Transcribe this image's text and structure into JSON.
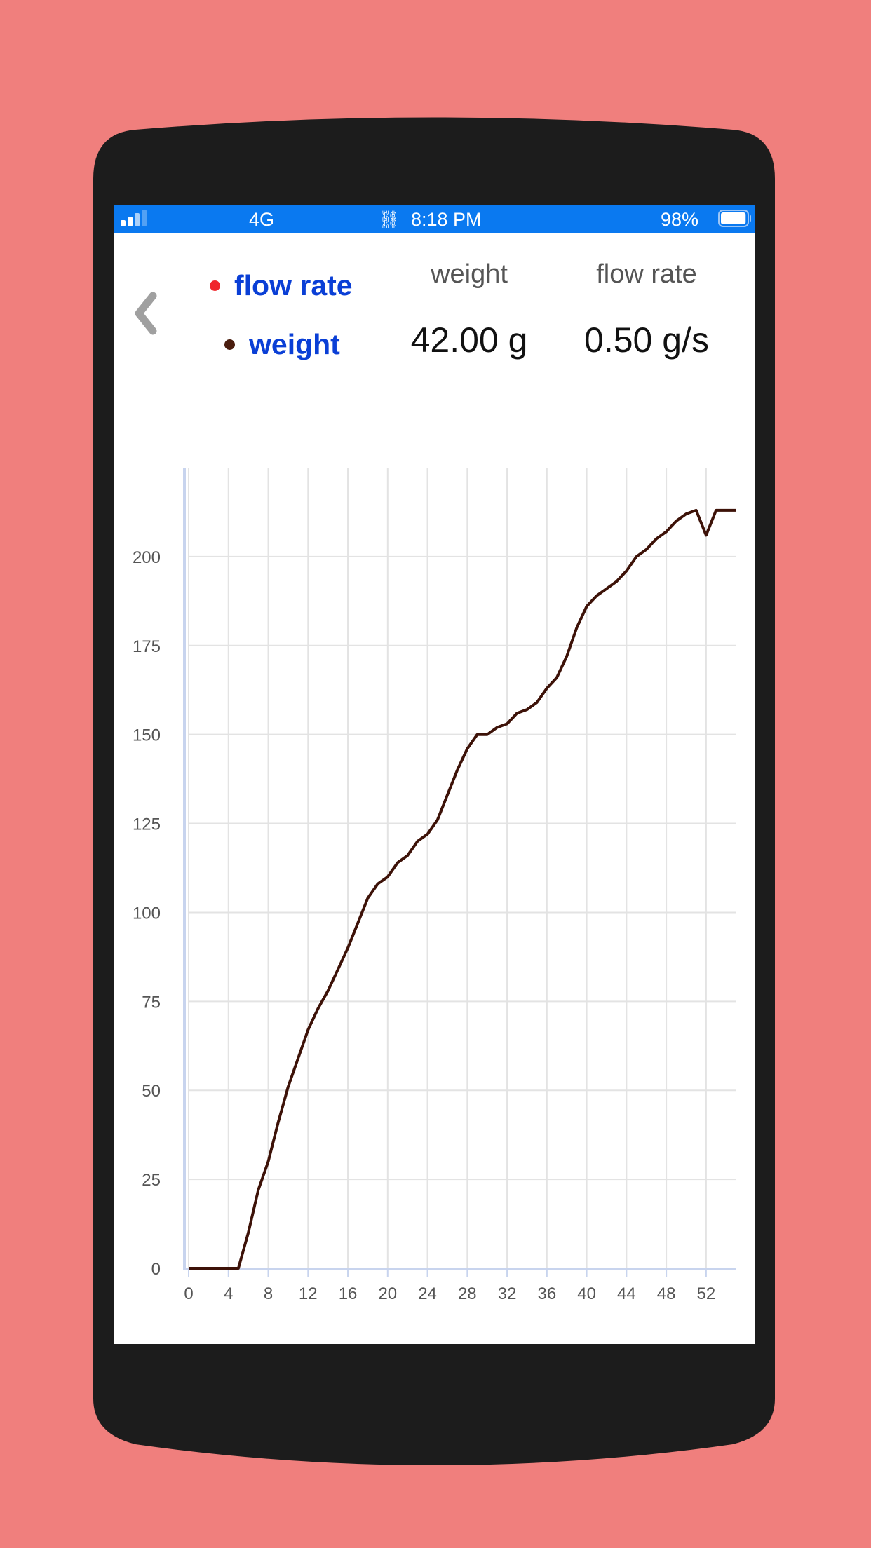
{
  "status_bar": {
    "network": "4G",
    "time": "8:18 PM",
    "battery_percent": "98%",
    "signal_bars_active": 2,
    "battery_level": 0.98
  },
  "header": {
    "back_icon": "chevron-left-icon",
    "legend": [
      {
        "label": "flow rate",
        "color": "#f0262b"
      },
      {
        "label": "weight",
        "color": "#4a1d0e"
      }
    ],
    "readouts": [
      {
        "label": "weight",
        "value": "42.00 g"
      },
      {
        "label": "flow rate",
        "value": "0.50 g/s"
      }
    ]
  },
  "colors": {
    "background": "#f07f7d",
    "phone_frame": "#1c1c1c",
    "status_bar": "#0a79f0",
    "legend_text": "#0a3fd6",
    "line": "#3d1208",
    "grid": "#e3e3e3",
    "axis": "#c8d4ee"
  },
  "chart_data": {
    "type": "line",
    "title": "",
    "xlabel": "",
    "ylabel": "",
    "xlim": [
      0,
      56
    ],
    "ylim": [
      0,
      225
    ],
    "grid": true,
    "legend": "none",
    "x_ticks": [
      0,
      4,
      8,
      12,
      16,
      20,
      24,
      28,
      32,
      36,
      40,
      44,
      48,
      52
    ],
    "y_ticks": [
      0,
      25,
      50,
      75,
      100,
      125,
      150,
      175,
      200
    ],
    "series": [
      {
        "name": "weight",
        "color": "#3d1208",
        "x": [
          0,
          1,
          2,
          3,
          4,
          5,
          6,
          7,
          8,
          9,
          10,
          11,
          12,
          13,
          14,
          15,
          16,
          17,
          18,
          19,
          20,
          21,
          22,
          23,
          24,
          25,
          26,
          27,
          28,
          29,
          30,
          31,
          32,
          33,
          34,
          35,
          36,
          37,
          38,
          39,
          40,
          41,
          42,
          43,
          44,
          45,
          46,
          47,
          48,
          49,
          50,
          51,
          52,
          53,
          54,
          55
        ],
        "values": [
          0,
          0,
          0,
          0,
          0,
          0,
          10,
          22,
          30,
          41,
          51,
          59,
          67,
          73,
          78,
          84,
          90,
          97,
          104,
          108,
          110,
          114,
          116,
          120,
          122,
          126,
          133,
          140,
          146,
          150,
          150,
          152,
          153,
          156,
          157,
          159,
          163,
          166,
          172,
          180,
          186,
          189,
          191,
          193,
          196,
          200,
          202,
          205,
          207,
          210,
          212,
          213,
          206,
          213,
          213,
          213
        ]
      }
    ]
  }
}
